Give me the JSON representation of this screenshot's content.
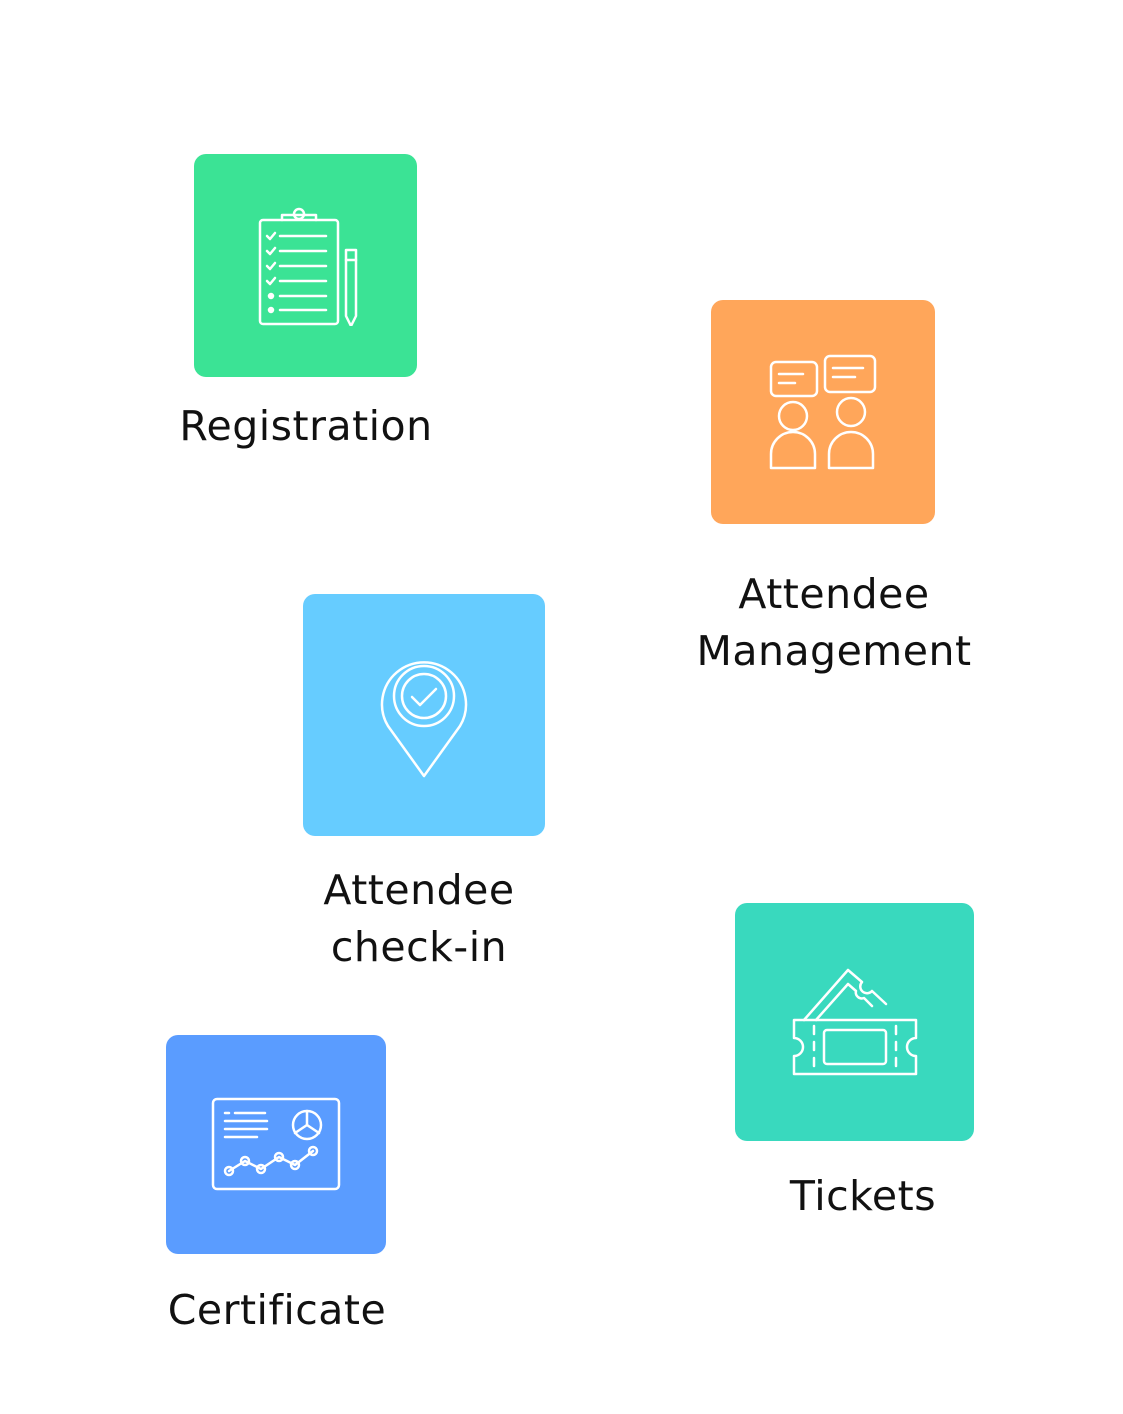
{
  "features": [
    {
      "label_lines": [
        "Registration"
      ],
      "icon": "clipboard-checklist-icon",
      "color": "#3BE395"
    },
    {
      "label_lines": [
        "Attendee",
        "Management"
      ],
      "icon": "people-chat-icon",
      "color": "#FFA65A"
    },
    {
      "label_lines": [
        "Attendee",
        "check-in"
      ],
      "icon": "location-check-icon",
      "color": "#66CCFF"
    },
    {
      "label_lines": [
        "Tickets"
      ],
      "icon": "tickets-icon",
      "color": "#39D9BE"
    },
    {
      "label_lines": [
        "Certificate"
      ],
      "icon": "certificate-chart-icon",
      "color": "#5A9CFF"
    }
  ]
}
